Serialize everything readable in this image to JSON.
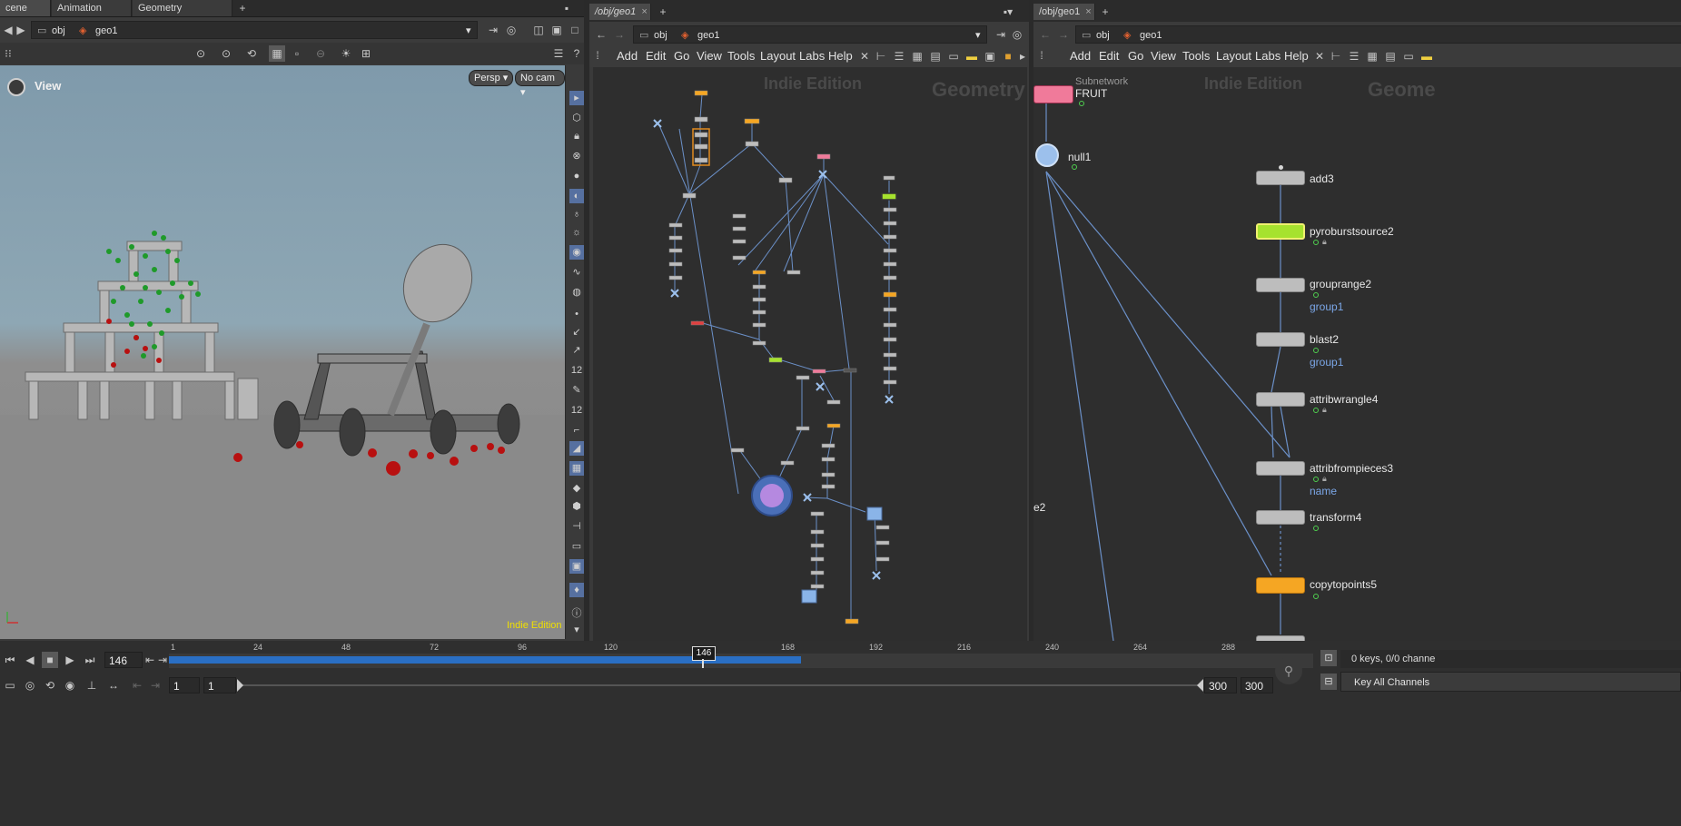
{
  "left_pane": {
    "tabs": [
      {
        "label": "cene View",
        "close": "×"
      },
      {
        "label": "Animation Editor",
        "close": "×"
      },
      {
        "label": "Geometry Spreadsheet",
        "close": "×"
      }
    ],
    "add_tab": "+",
    "path": {
      "root": "obj",
      "node": "geo1"
    },
    "view_label": "View",
    "persp_label": "Persp ▾",
    "cam_label": "No cam ▾",
    "watermark": "Indie Edition"
  },
  "middle_pane": {
    "tabs": [
      {
        "label": "/obj/geo1",
        "close": "×"
      }
    ],
    "add_tab": "+",
    "path": {
      "root": "obj",
      "node": "geo1"
    },
    "menus": [
      "Add",
      "Edit",
      "Go",
      "View",
      "Tools",
      "Layout",
      "Labs",
      "Help"
    ],
    "watermark_edition": "Indie Edition",
    "watermark_context": "Geometry"
  },
  "right_pane": {
    "tabs": [
      {
        "label": "/obj/geo1",
        "close": "×"
      }
    ],
    "add_tab": "+",
    "path": {
      "root": "obj",
      "node": "geo1"
    },
    "menus": [
      "Add",
      "Edit",
      "Go",
      "View",
      "Tools",
      "Layout",
      "Labs",
      "Help"
    ],
    "watermark_edition": "Indie Edition",
    "watermark_context": "Geome",
    "subnet_type": "Subnetwork",
    "subnet_name": "FRUIT",
    "null_name": "null1",
    "partial_label": "e2",
    "nodes": [
      {
        "name": "add3",
        "group": ""
      },
      {
        "name": "pyroburstsource2",
        "group": ""
      },
      {
        "name": "grouprange2",
        "group": "group1"
      },
      {
        "name": "blast2",
        "group": "group1"
      },
      {
        "name": "attribwrangle4",
        "group": ""
      },
      {
        "name": "attribfrompieces3",
        "group": "name"
      },
      {
        "name": "transform4",
        "group": ""
      },
      {
        "name": "copytopoints5",
        "group": ""
      }
    ]
  },
  "timeline": {
    "current_frame": "146",
    "marker": "146",
    "ticks": [
      "1",
      "24",
      "48",
      "72",
      "96",
      "120",
      "168",
      "192",
      "216",
      "240",
      "264",
      "288"
    ],
    "start_a": "1",
    "start_b": "1",
    "end_a": "300",
    "end_b": "300",
    "keys_label": "0 keys, 0/0 channe",
    "key_all_label": "Key All Channels"
  },
  "colors": {
    "selected_node": "#a6e22e",
    "orange_node": "#f5a623",
    "pink_node": "#f07a9a",
    "timeline_range": "#2a6fc4"
  }
}
